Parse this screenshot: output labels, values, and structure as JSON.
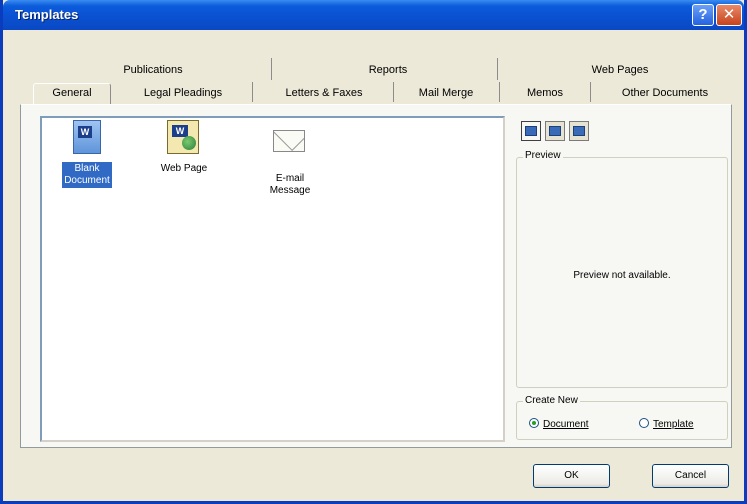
{
  "window": {
    "title": "Templates"
  },
  "titlebar": {
    "help_glyph": "?",
    "close_glyph": "✕"
  },
  "tabs": {
    "row_top": [
      {
        "label": "Publications"
      },
      {
        "label": "Reports"
      },
      {
        "label": "Web Pages"
      }
    ],
    "row_bottom": [
      {
        "label": "General",
        "active": true
      },
      {
        "label": "Legal Pleadings"
      },
      {
        "label": "Letters & Faxes"
      },
      {
        "label": "Mail Merge"
      },
      {
        "label": "Memos"
      },
      {
        "label": "Other Documents"
      }
    ]
  },
  "templates": [
    {
      "label_line1": "Blank",
      "label_line2": "Document",
      "icon": "word-document-icon",
      "selected": true
    },
    {
      "label_line1": "Web Page",
      "label_line2": "",
      "icon": "web-page-icon",
      "selected": false
    },
    {
      "label_line1": "E-mail",
      "label_line2": "Message",
      "icon": "envelope-icon",
      "selected": false
    }
  ],
  "view_buttons": [
    {
      "icon": "large-icons-view-icon",
      "pressed": true
    },
    {
      "icon": "list-view-icon",
      "pressed": false
    },
    {
      "icon": "details-view-icon",
      "pressed": false
    }
  ],
  "preview": {
    "label": "Preview",
    "message": "Preview not available."
  },
  "create_new": {
    "label": "Create New",
    "option_document": "Document",
    "option_template": "Template",
    "selected": "Document"
  },
  "buttons": {
    "ok": "OK",
    "cancel": "Cancel"
  },
  "colors": {
    "title_bar": "#0A50D0",
    "selection": "#316AC5",
    "dialog_bg": "#ECE9D8"
  }
}
